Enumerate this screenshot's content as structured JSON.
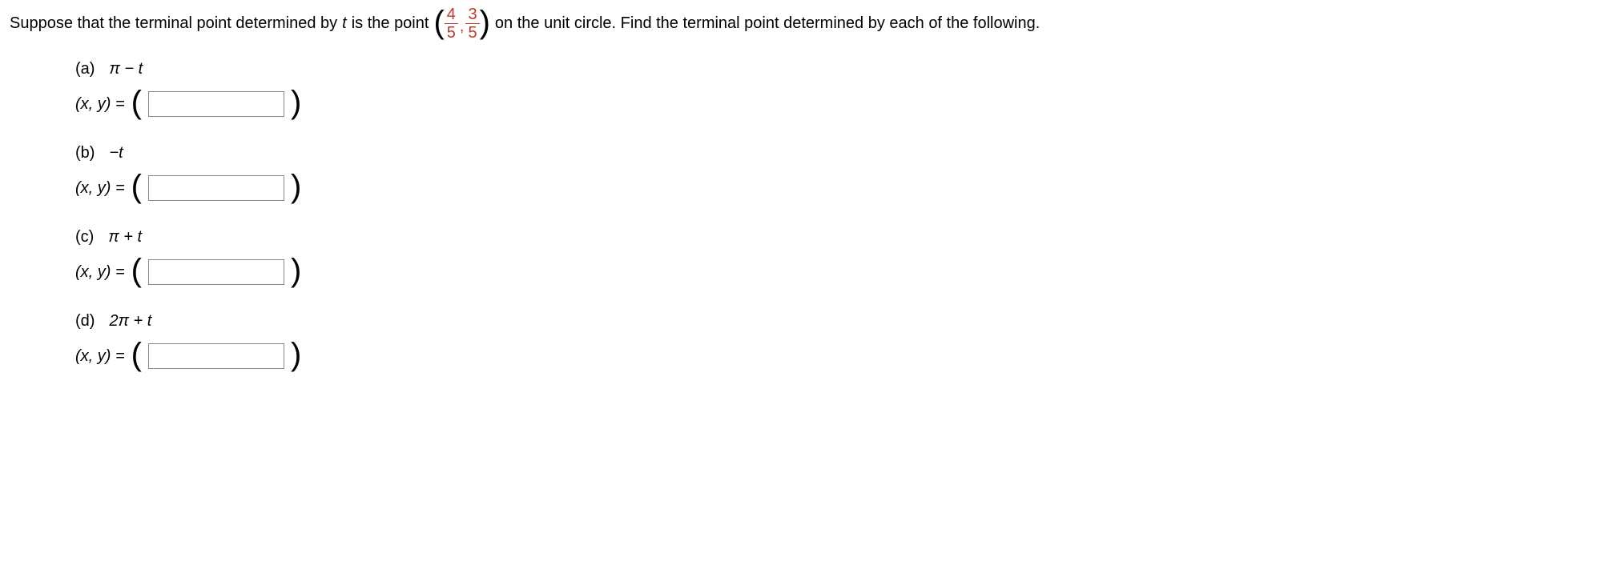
{
  "prompt": {
    "pre": "Suppose that the terminal point determined by ",
    "tvar": "t",
    "mid": " is the point ",
    "fracA_num": "4",
    "fracA_den": "5",
    "comma": ",",
    "fracB_num": "3",
    "fracB_den": "5",
    "post": " on the unit circle. Find the terminal point determined by each of the following."
  },
  "parts": [
    {
      "label": "(a)",
      "expr": "π − t",
      "xy": "(x, y) ="
    },
    {
      "label": "(b)",
      "expr": "−t",
      "xy": "(x, y) ="
    },
    {
      "label": "(c)",
      "expr": "π + t",
      "xy": "(x, y) ="
    },
    {
      "label": "(d)",
      "expr": "2π + t",
      "xy": "(x, y) ="
    }
  ]
}
